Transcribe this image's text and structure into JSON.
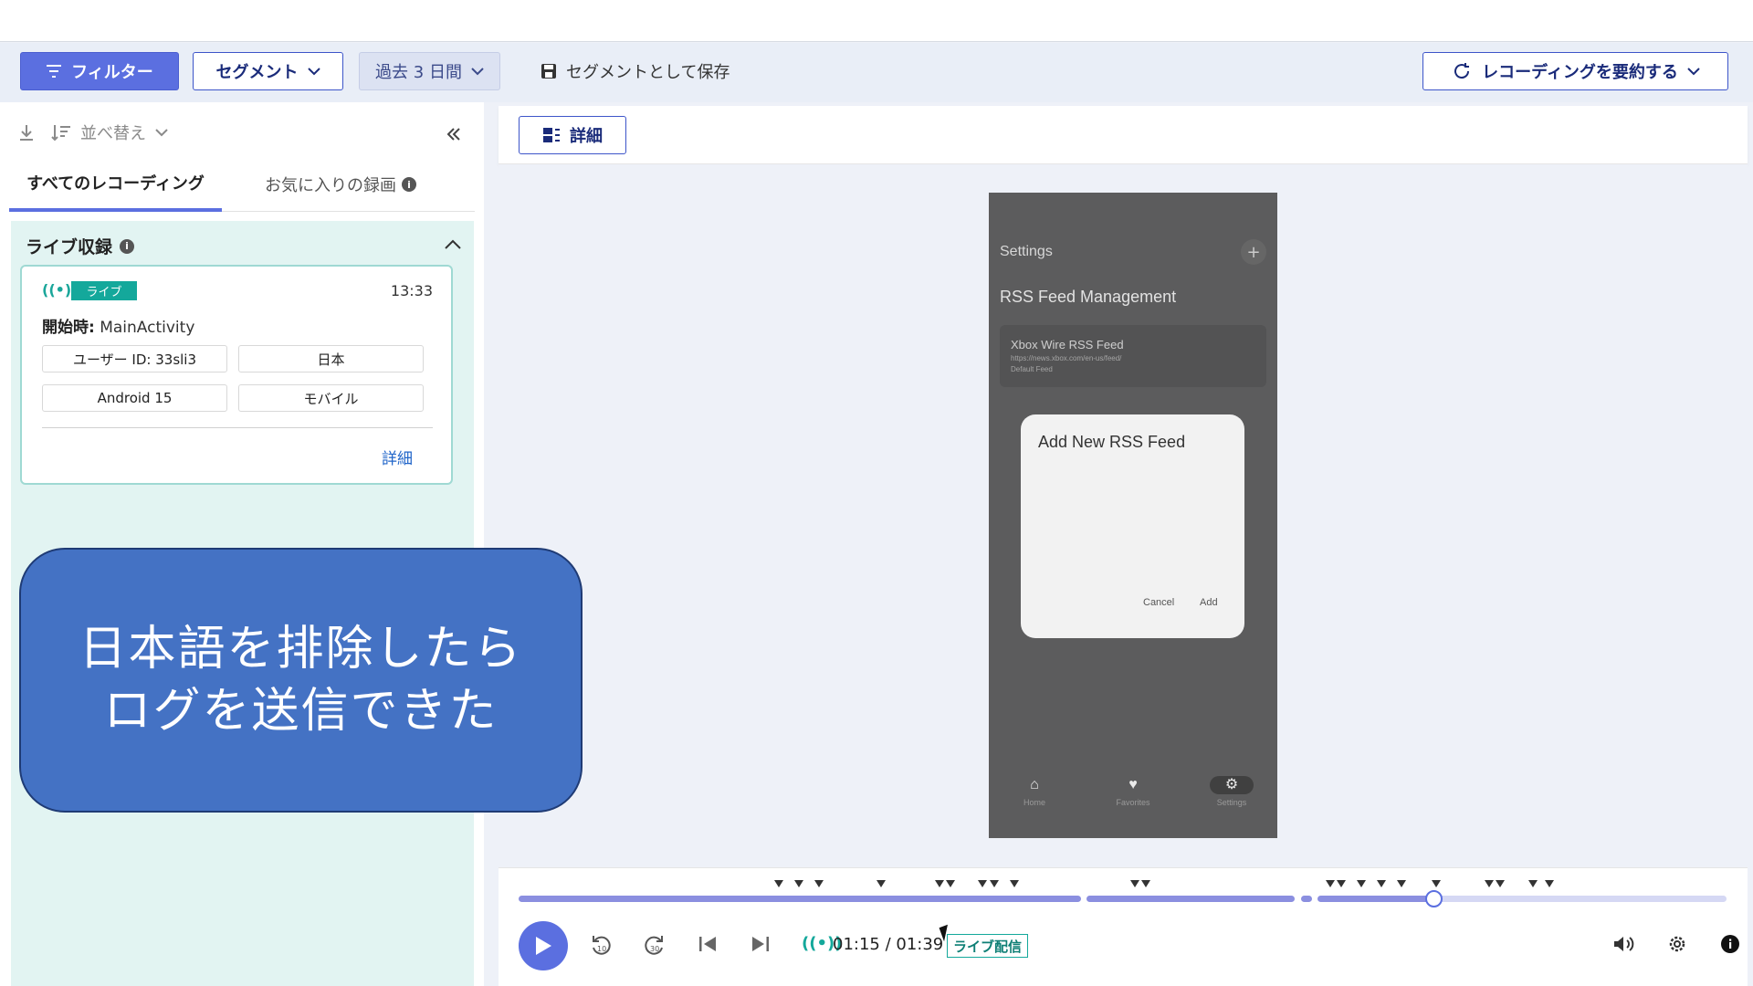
{
  "toolbar": {
    "filter_label": "フィルター",
    "segment_label": "セグメント",
    "days_label": "過去 3 日間",
    "save_segment_label": "セグメントとして保存",
    "summarize_label": "レコーディングを要約する"
  },
  "left_panel": {
    "sort_label": "並べ替え",
    "tabs": [
      {
        "label": "すべてのレコーディング",
        "active": true
      },
      {
        "label": "お気に入りの録画",
        "active": false
      }
    ],
    "live_section": {
      "title": "ライブ収録",
      "card": {
        "badge": "ライブ",
        "time": "13:33",
        "start_label": "開始時:",
        "start_value": "MainActivity",
        "pills": [
          "ユーザー ID: 33sli3",
          "日本",
          "Android 15",
          "モバイル"
        ],
        "detail_link": "詳細"
      }
    }
  },
  "callout": {
    "line1": "日本語を排除したら",
    "line2": "ログを送信できた",
    "color": "#4472c4"
  },
  "main": {
    "detail_button": "詳細"
  },
  "phone": {
    "title": "Settings",
    "heading": "RSS Feed Management",
    "feed": {
      "title": "Xbox Wire RSS Feed",
      "url": "https://news.xbox.com/en-us/feed/",
      "sub": "Default Feed"
    },
    "dialog": {
      "title": "Add New RSS Feed",
      "cancel": "Cancel",
      "add": "Add"
    },
    "nav": [
      "Home",
      "Favorites",
      "Settings"
    ]
  },
  "player": {
    "time": "01:15 / 01:39",
    "live_tag": "ライブ配信",
    "progress": 0.757,
    "accent": "#5b6fe0"
  }
}
